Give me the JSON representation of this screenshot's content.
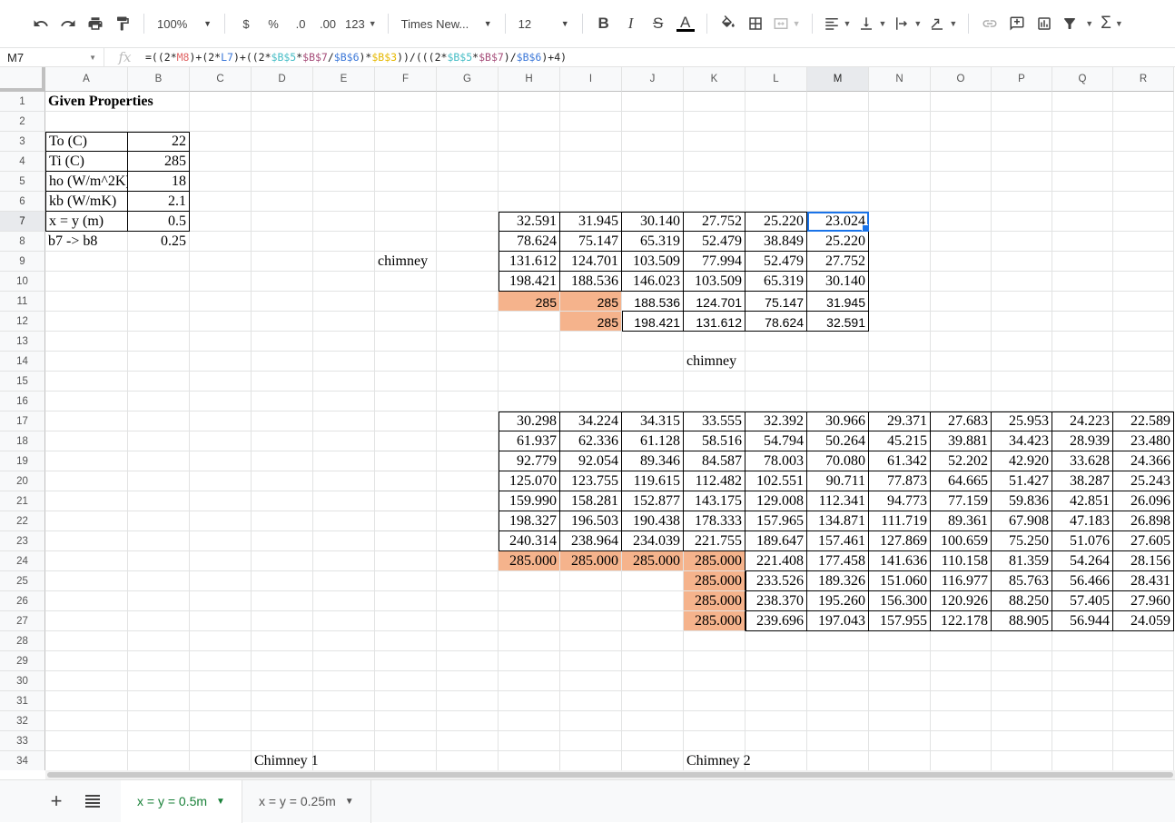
{
  "toolbar": {
    "zoom": "100%",
    "currency": "$",
    "percent": "%",
    "decrease_decimal": ".0",
    "increase_decimal": ".00",
    "number_format": "123",
    "font": "Times New...",
    "font_size": "12"
  },
  "formula_bar": {
    "cell_ref": "M7",
    "fx": "fx",
    "formula_parts": [
      {
        "t": "=((2*",
        "c": "#222"
      },
      {
        "t": "M8",
        "c": "#e06666"
      },
      {
        "t": ")+(2*",
        "c": "#222"
      },
      {
        "t": "L7",
        "c": "#3c78d8"
      },
      {
        "t": ")+((2*",
        "c": "#222"
      },
      {
        "t": "$B$5",
        "c": "#46bdc6"
      },
      {
        "t": "*",
        "c": "#222"
      },
      {
        "t": "$B$7",
        "c": "#a64d79"
      },
      {
        "t": "/",
        "c": "#222"
      },
      {
        "t": "$B$6",
        "c": "#3c78d8"
      },
      {
        "t": ")*",
        "c": "#222"
      },
      {
        "t": "$B$3",
        "c": "#e6b800"
      },
      {
        "t": "))/(((2*",
        "c": "#222"
      },
      {
        "t": "$B$5",
        "c": "#46bdc6"
      },
      {
        "t": "*",
        "c": "#222"
      },
      {
        "t": "$B$7",
        "c": "#a64d79"
      },
      {
        "t": ")/",
        "c": "#222"
      },
      {
        "t": "$B$6",
        "c": "#3c78d8"
      },
      {
        "t": ")+4)",
        "c": "#222"
      }
    ]
  },
  "columns": [
    "A",
    "B",
    "C",
    "D",
    "E",
    "F",
    "G",
    "H",
    "I",
    "J",
    "K",
    "L",
    "M",
    "N",
    "O",
    "P",
    "Q",
    "R"
  ],
  "rows": [
    "1",
    "2",
    "3",
    "4",
    "5",
    "6",
    "7",
    "8",
    "9",
    "10",
    "11",
    "12",
    "13",
    "14",
    "15",
    "16",
    "17",
    "18",
    "19",
    "20",
    "21",
    "22",
    "23",
    "24",
    "25",
    "26",
    "27",
    "28",
    "29",
    "30",
    "31",
    "32",
    "33",
    "34"
  ],
  "selected": {
    "col": "M",
    "row": "7"
  },
  "cells": {
    "A1": "Given Properties",
    "A3": "To (C)",
    "B3": "22",
    "A4": "Ti (C)",
    "B4": "285",
    "A5": "ho (W/m^2K)",
    "B5": "18",
    "A6": "kb (W/mK)",
    "B6": "2.1",
    "A7": "x = y (m)",
    "B7": "0.5",
    "A8": "b7 -> b8",
    "B8": "0.25",
    "F9": "chimney",
    "K14": "chimney",
    "D34": "Chimney 1",
    "K34": "Chimney 2",
    "H7": "32.591",
    "I7": "31.945",
    "J7": "30.140",
    "K7": "27.752",
    "L7": "25.220",
    "M7": "23.024",
    "H8": "78.624",
    "I8": "75.147",
    "J8": "65.319",
    "K8": "52.479",
    "L8": "38.849",
    "M8": "25.220",
    "H9": "131.612",
    "I9": "124.701",
    "J9": "103.509",
    "K9": "77.994",
    "L9": "52.479",
    "M9": "27.752",
    "H10": "198.421",
    "I10": "188.536",
    "J10": "146.023",
    "K10": "103.509",
    "L10": "65.319",
    "M10": "30.140",
    "H11": "285",
    "I11": "285",
    "J11": "188.536",
    "K11": "124.701",
    "L11": "75.147",
    "M11": "31.945",
    "I12": "285",
    "J12": "198.421",
    "K12": "131.612",
    "L12": "78.624",
    "M12": "32.591",
    "H17": "30.298",
    "I17": "34.224",
    "J17": "34.315",
    "K17": "33.555",
    "L17": "32.392",
    "M17": "30.966",
    "N17": "29.371",
    "O17": "27.683",
    "P17": "25.953",
    "Q17": "24.223",
    "R17": "22.589",
    "H18": "61.937",
    "I18": "62.336",
    "J18": "61.128",
    "K18": "58.516",
    "L18": "54.794",
    "M18": "50.264",
    "N18": "45.215",
    "O18": "39.881",
    "P18": "34.423",
    "Q18": "28.939",
    "R18": "23.480",
    "H19": "92.779",
    "I19": "92.054",
    "J19": "89.346",
    "K19": "84.587",
    "L19": "78.003",
    "M19": "70.080",
    "N19": "61.342",
    "O19": "52.202",
    "P19": "42.920",
    "Q19": "33.628",
    "R19": "24.366",
    "H20": "125.070",
    "I20": "123.755",
    "J20": "119.615",
    "K20": "112.482",
    "L20": "102.551",
    "M20": "90.711",
    "N20": "77.873",
    "O20": "64.665",
    "P20": "51.427",
    "Q20": "38.287",
    "R20": "25.243",
    "H21": "159.990",
    "I21": "158.281",
    "J21": "152.877",
    "K21": "143.175",
    "L21": "129.008",
    "M21": "112.341",
    "N21": "94.773",
    "O21": "77.159",
    "P21": "59.836",
    "Q21": "42.851",
    "R21": "26.096",
    "H22": "198.327",
    "I22": "196.503",
    "J22": "190.438",
    "K22": "178.333",
    "L22": "157.965",
    "M22": "134.871",
    "N22": "111.719",
    "O22": "89.361",
    "P22": "67.908",
    "Q22": "47.183",
    "R22": "26.898",
    "H23": "240.314",
    "I23": "238.964",
    "J23": "234.039",
    "K23": "221.755",
    "L23": "189.647",
    "M23": "157.461",
    "N23": "127.869",
    "O23": "100.659",
    "P23": "75.250",
    "Q23": "51.076",
    "R23": "27.605",
    "H24": "285.000",
    "I24": "285.000",
    "J24": "285.000",
    "K24": "285.000",
    "L24": "221.408",
    "M24": "177.458",
    "N24": "141.636",
    "O24": "110.158",
    "P24": "81.359",
    "Q24": "54.264",
    "R24": "28.156",
    "K25": "285.000",
    "L25": "233.526",
    "M25": "189.326",
    "N25": "151.060",
    "O25": "116.977",
    "P25": "85.763",
    "Q25": "56.466",
    "R25": "28.431",
    "K26": "285.000",
    "L26": "238.370",
    "M26": "195.260",
    "N26": "156.300",
    "O26": "120.926",
    "P26": "88.250",
    "Q26": "57.405",
    "R26": "27.960",
    "K27": "285.000",
    "L27": "239.696",
    "M27": "197.043",
    "N27": "157.955",
    "O27": "122.178",
    "P27": "88.905",
    "Q27": "56.944",
    "R27": "24.059"
  },
  "sheets": [
    {
      "name": "x = y = 0.5m",
      "active": true
    },
    {
      "name": "x = y = 0.25m",
      "active": false
    }
  ],
  "colors": {
    "accent": "#1a73e8",
    "highlight": "#f5b38c",
    "active_tab": "#188038"
  }
}
